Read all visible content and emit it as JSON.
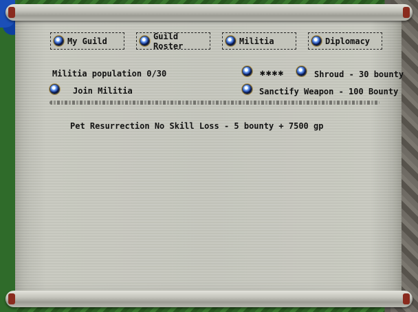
{
  "tabs": [
    {
      "label": "My Guild"
    },
    {
      "label": "Guild Roster"
    },
    {
      "label": "Militia"
    },
    {
      "label": "Diplomacy"
    }
  ],
  "militia": {
    "population": "Militia population 0/30",
    "join_label": "Join Militia",
    "stars": "✱✱✱✱",
    "shroud": "Shroud - 30 bounty",
    "sanctify": "Sanctify Weapon - 100 Bounty",
    "reward": "Pet Resurrection No Skill Loss - 5 bounty + 7500 gp"
  },
  "colors": {
    "parchment": "#c6c7be",
    "text": "#121212",
    "gem": "#1d3f9a"
  }
}
